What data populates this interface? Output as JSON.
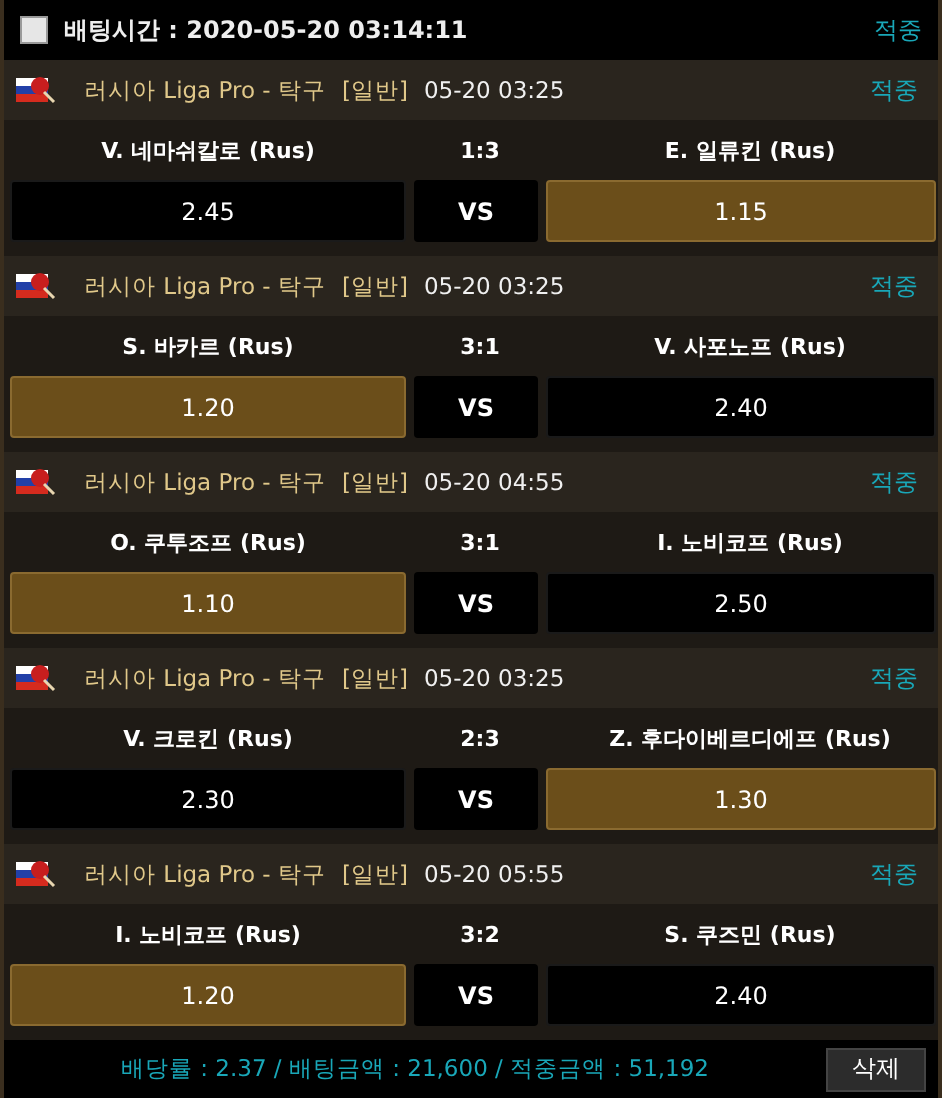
{
  "header": {
    "checked": false,
    "label": "배팅시간 : 2020-05-20 03:14:11",
    "status": "적중"
  },
  "matches": [
    {
      "league": "러시아 Liga Pro - 탁구",
      "type": "[일반]",
      "time": "05-20 03:25",
      "status": "적중",
      "home": "V. 네마쉬칼로 (Rus)",
      "score": "1:3",
      "away": "E. 일류킨 (Rus)",
      "home_odds": {
        "value": "2.45",
        "selected": false
      },
      "vs": "VS",
      "away_odds": {
        "value": "1.15",
        "selected": true
      }
    },
    {
      "league": "러시아 Liga Pro - 탁구",
      "type": "[일반]",
      "time": "05-20 03:25",
      "status": "적중",
      "home": "S. 바카르 (Rus)",
      "score": "3:1",
      "away": "V. 사포노프 (Rus)",
      "home_odds": {
        "value": "1.20",
        "selected": true
      },
      "vs": "VS",
      "away_odds": {
        "value": "2.40",
        "selected": false
      }
    },
    {
      "league": "러시아 Liga Pro - 탁구",
      "type": "[일반]",
      "time": "05-20 04:55",
      "status": "적중",
      "home": "O. 쿠투조프 (Rus)",
      "score": "3:1",
      "away": "I. 노비코프 (Rus)",
      "home_odds": {
        "value": "1.10",
        "selected": true
      },
      "vs": "VS",
      "away_odds": {
        "value": "2.50",
        "selected": false
      }
    },
    {
      "league": "러시아 Liga Pro - 탁구",
      "type": "[일반]",
      "time": "05-20 03:25",
      "status": "적중",
      "home": "V. 크로킨 (Rus)",
      "score": "2:3",
      "away": "Z. 후다이베르디에프 (Rus)",
      "home_odds": {
        "value": "2.30",
        "selected": false
      },
      "vs": "VS",
      "away_odds": {
        "value": "1.30",
        "selected": true
      }
    },
    {
      "league": "러시아 Liga Pro - 탁구",
      "type": "[일반]",
      "time": "05-20 05:55",
      "status": "적중",
      "home": "I. 노비코프 (Rus)",
      "score": "3:2",
      "away": "S. 쿠즈민 (Rus)",
      "home_odds": {
        "value": "1.20",
        "selected": true
      },
      "vs": "VS",
      "away_odds": {
        "value": "2.40",
        "selected": false
      }
    }
  ],
  "footer": {
    "summary": "배당률 : 2.37 / 배팅금액 : 21,600 / 적중금액 : 51,192",
    "delete_button": "삭제"
  }
}
